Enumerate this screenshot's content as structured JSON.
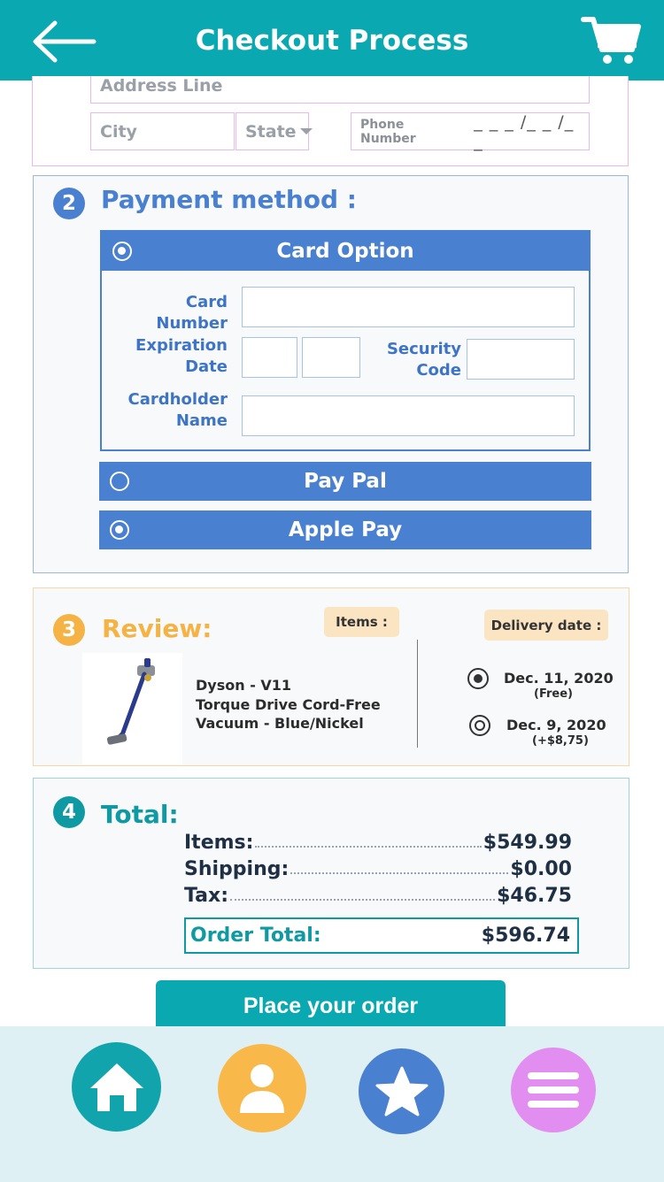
{
  "header": {
    "title": "Checkout Process",
    "back_icon": "arrow-left-icon",
    "cart_icon": "shopping-cart-icon",
    "color": "#0aa8b0"
  },
  "address": {
    "address_line_placeholder": "Address Line",
    "city_placeholder": "City",
    "state_placeholder": "State",
    "phone_label": "Phone Number",
    "phone_mask": "_ _ _ /_ _ /_ _"
  },
  "payment": {
    "step": "2",
    "title": "Payment method :",
    "accent": "#4a80d0",
    "card_option": {
      "label": "Card Option",
      "card_number_label": "Card Number",
      "expiration_label_1": "Expiration",
      "expiration_label_2": "Date",
      "security_label_1": "Security",
      "security_label_2": "Code",
      "cardholder_label_1": "Cardholder",
      "cardholder_label_2": "Name"
    },
    "paypal_label": "Pay Pal",
    "applepay_label": "Apple Pay"
  },
  "review": {
    "step": "3",
    "title": "Review:",
    "accent": "#f6b345",
    "items_label": "Items :",
    "delivery_label": "Delivery date :",
    "product_line_1": "Dyson - V11",
    "product_line_2": "Torque Drive Cord-Free",
    "product_line_3": "Vacuum - Blue/Nickel",
    "delivery_options": [
      {
        "date": "Dec. 11, 2020",
        "note": "(Free)",
        "selected": true
      },
      {
        "date": "Dec. 9, 2020",
        "note": "(+$8,75)",
        "selected": false
      }
    ]
  },
  "total": {
    "step": "4",
    "title": "Total:",
    "accent": "#0f9aa3",
    "items_label": "Items:",
    "items_value": "$549.99",
    "shipping_label": "Shipping:",
    "shipping_value": "$0.00",
    "tax_label": "Tax:",
    "tax_value": "$46.75",
    "order_total_label": "Order Total:",
    "order_total_value": "$596.74"
  },
  "place_order_label": "Place your order",
  "nav": {
    "home_icon": "home-icon",
    "profile_icon": "user-icon",
    "favorites_icon": "star-icon",
    "menu_icon": "menu-icon",
    "colors": [
      "#12a4ad",
      "#f8b84a",
      "#4a80d0",
      "#e28ef0"
    ]
  }
}
